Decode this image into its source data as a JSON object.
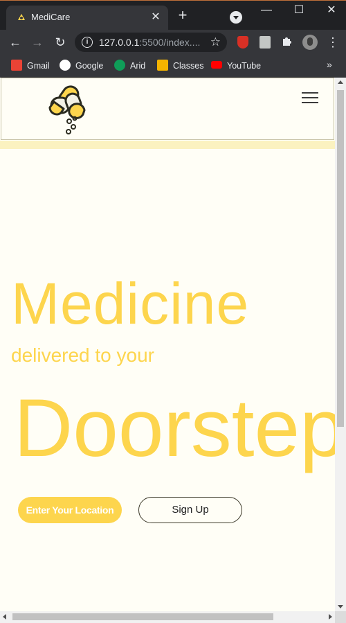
{
  "browser": {
    "tab": {
      "title": "MediCare",
      "close_glyph": "✕",
      "favicon": "medicare-logo-icon"
    },
    "new_tab_glyph": "+",
    "window_controls": {
      "minimize": "—",
      "maximize": "☐",
      "close": "✕"
    },
    "nav": {
      "back": "←",
      "forward": "→",
      "reload": "↻"
    },
    "address": {
      "host": "127.0.0.1",
      "rest": ":5500/index....",
      "info_glyph": "i",
      "star_glyph": "☆"
    },
    "extensions": [
      "adblock-icon",
      "document-icon",
      "puzzle-icon"
    ],
    "menu_glyph": "⋮",
    "bookmarks": [
      {
        "label": "Gmail",
        "icon": "gmail-icon",
        "color": "#ea4335"
      },
      {
        "label": "Google",
        "icon": "google-icon",
        "color": "#4285f4"
      },
      {
        "label": "Arid",
        "icon": "arid-icon",
        "color": "#0f9d58"
      },
      {
        "label": "Classes",
        "icon": "classroom-icon",
        "color": "#f4b400"
      },
      {
        "label": "YouTube",
        "icon": "youtube-icon",
        "color": "#ff0000"
      }
    ],
    "bookmarks_more": "»"
  },
  "page": {
    "hero": {
      "line1": "Medicine",
      "line2": "delivered to your",
      "line3": "Doorstep"
    },
    "buttons": {
      "location": "Enter Your Location",
      "signup": "Sign Up"
    },
    "colors": {
      "accent": "#fdd54d",
      "background": "#fffef6",
      "strip": "#fbf2c0"
    }
  }
}
